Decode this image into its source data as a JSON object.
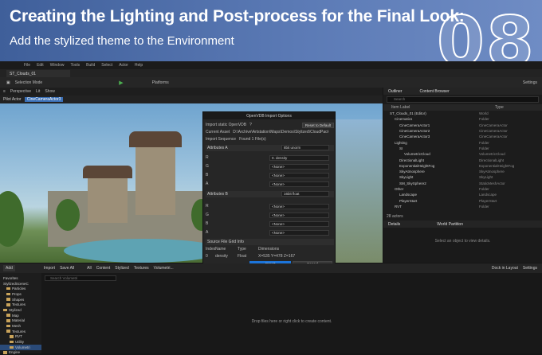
{
  "banner": {
    "title": "Creating the Lighting and Post-process for the Final Look:",
    "subtitle": "Add the stylized theme to the Environment",
    "number": "08"
  },
  "menu": [
    "File",
    "Edit",
    "Window",
    "Tools",
    "Build",
    "Select",
    "Actor",
    "Help"
  ],
  "editor": {
    "tab": "ST_Clouds_01",
    "mode": "Selection Mode",
    "platforms": "Platforms",
    "settings": "Settings"
  },
  "viewport": {
    "perspective": "Perspective",
    "lit": "Lit",
    "show": "Show",
    "pilot": "Pilot Actor",
    "camera": "CineCameraActor3"
  },
  "dialog": {
    "title": "OpenVDB Import Options",
    "import_static_label": "Import static OpenVDB",
    "reset": "Reset to Default",
    "current_asset_label": "Current Asset",
    "current_asset_value": "D:\\Archive\\Artstation\\Maps\\Demos\\Stylized\\CloudPack\\VDB\\Cloud",
    "sequence_label": "Import Sequence",
    "sequence_value": "Found 1 File(s)",
    "attributes_a": "Attributes A",
    "format_a": "8bit unorm",
    "rows_a": [
      {
        "ch": "R",
        "val": "0. density"
      },
      {
        "ch": "G",
        "val": "<None>"
      },
      {
        "ch": "B",
        "val": "<None>"
      },
      {
        "ch": "A",
        "val": "<None>"
      }
    ],
    "attributes_b": "Attributes B",
    "format_b": "16bit float",
    "rows_b": [
      {
        "ch": "R",
        "val": "<None>"
      },
      {
        "ch": "G",
        "val": "<None>"
      },
      {
        "ch": "B",
        "val": "<None>"
      },
      {
        "ch": "A",
        "val": "<None>"
      }
    ],
    "grid_info": "Source File Grid Info",
    "grid_headers": [
      "Index",
      "Name",
      "Type",
      "Dimensions"
    ],
    "grid_row": [
      "0",
      "density",
      "Float",
      "X=535 Y=478 Z=167"
    ],
    "import_btn": "Import",
    "cancel_btn": "Cancel"
  },
  "outliner": {
    "tab1": "Outliner",
    "tab2": "Content Browser",
    "search": "Search",
    "col_label": "Item Label",
    "col_type": "Type",
    "rows": [
      {
        "label": "ST_Clouds_01 (Editor)",
        "type": "World"
      },
      {
        "label": "Cinematics",
        "type": "Folder"
      },
      {
        "label": "CineCameraActor1",
        "type": "CineCameraActor"
      },
      {
        "label": "CineCameraActor2",
        "type": "CineCameraActor"
      },
      {
        "label": "CineCameraActor3",
        "type": "CineCameraActor"
      },
      {
        "label": "Lighting",
        "type": "Folder"
      },
      {
        "label": "SI",
        "type": "Folder"
      },
      {
        "label": "VolumetricCloud",
        "type": "VolumetricCloud"
      },
      {
        "label": "DirectionalLight",
        "type": "DirectionalLight"
      },
      {
        "label": "ExponentialHeightFog",
        "type": "ExponentialHeightFog"
      },
      {
        "label": "SkyAtmosphere",
        "type": "SkyAtmosphere"
      },
      {
        "label": "SkyLight",
        "type": "SkyLight"
      },
      {
        "label": "SM_SkySphere2",
        "type": "StaticMeshActor"
      },
      {
        "label": "Other",
        "type": "Folder"
      },
      {
        "label": "Landscape",
        "type": "Landscape"
      },
      {
        "label": "PlayerStart",
        "type": "PlayerStart"
      },
      {
        "label": "RVT",
        "type": "Folder"
      }
    ],
    "count": "28 actors"
  },
  "details": {
    "tab1": "Details",
    "tab2": "World Partition",
    "hint": "Select an object to view details."
  },
  "content": {
    "add": "Add",
    "import": "Import",
    "save_all": "Save All",
    "path": [
      "All",
      "Content",
      "Stylized",
      "Textures",
      "Volumetri..."
    ],
    "dock": "Dock in Layout",
    "settings": "Settings",
    "favorites": "Favorites",
    "root": "StylizedSceneC",
    "search": "Search Volumetri",
    "drop_hint": "Drop files here or right click to create content.",
    "folders": [
      "Particles",
      "Props",
      "Shapes",
      "Textures",
      "Stylized",
      "Map",
      "Material",
      "Mesh",
      "Textures",
      "RVT",
      "Utility",
      "Volumetri",
      "Engine"
    ]
  },
  "colors": {
    "banner": "#4e6ea8",
    "accent": "#1c74d9",
    "play": "#4caf50"
  }
}
